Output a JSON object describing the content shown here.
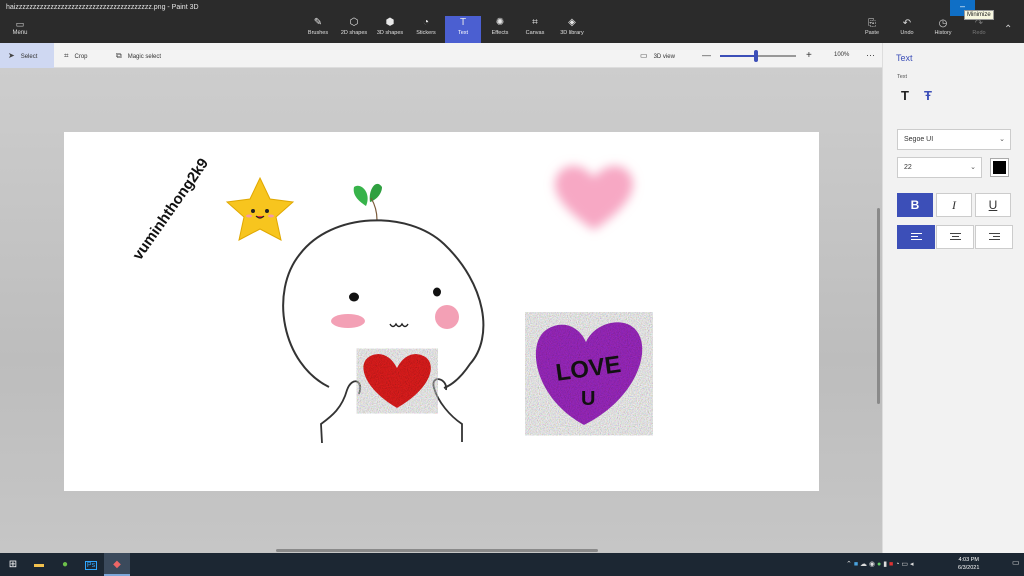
{
  "window": {
    "title": "haizzzzzzzzzzzzzzzzzzzzzzzzzzzzzzzzzzzzzzz.png - Paint 3D",
    "minimize_tooltip": "Minimize"
  },
  "topbar": {
    "menu_label": "Menu",
    "tools": [
      {
        "label": "Brushes",
        "icon": "brush-icon"
      },
      {
        "label": "2D shapes",
        "icon": "2d-shapes-icon"
      },
      {
        "label": "3D shapes",
        "icon": "3d-shapes-icon"
      },
      {
        "label": "Stickers",
        "icon": "stickers-icon"
      },
      {
        "label": "Text",
        "icon": "text-icon",
        "active": true
      },
      {
        "label": "Effects",
        "icon": "effects-icon"
      },
      {
        "label": "Canvas",
        "icon": "canvas-icon"
      },
      {
        "label": "3D library",
        "icon": "3d-library-icon"
      }
    ],
    "paste_label": "Paste",
    "undo_label": "Undo",
    "history_label": "History",
    "redo_label": "Redo"
  },
  "toolbar2": {
    "select_label": "Select",
    "crop_label": "Crop",
    "magic_select_label": "Magic select",
    "view3d_label": "3D view",
    "zoom_minus": "—",
    "zoom_plus": "+",
    "zoom_value": "100%",
    "zoom_fraction": 0.48,
    "more": "···"
  },
  "canvas": {
    "text_label": "vuminhthong2k9",
    "heart_text_1": "LOVE",
    "heart_text_2": "U"
  },
  "panel": {
    "title": "Text",
    "subtitle": "Text",
    "font_name": "Segoe UI",
    "font_size": "22",
    "text_color": "#000000",
    "bold": "B",
    "italic": "I",
    "underline": "U"
  },
  "taskbar": {
    "time": "4:03 PM",
    "date": "6/3/2021"
  },
  "colors": {
    "accent": "#4b5fd1",
    "toolbar": "#2b2b2b",
    "panel": "#f2f2f2"
  }
}
